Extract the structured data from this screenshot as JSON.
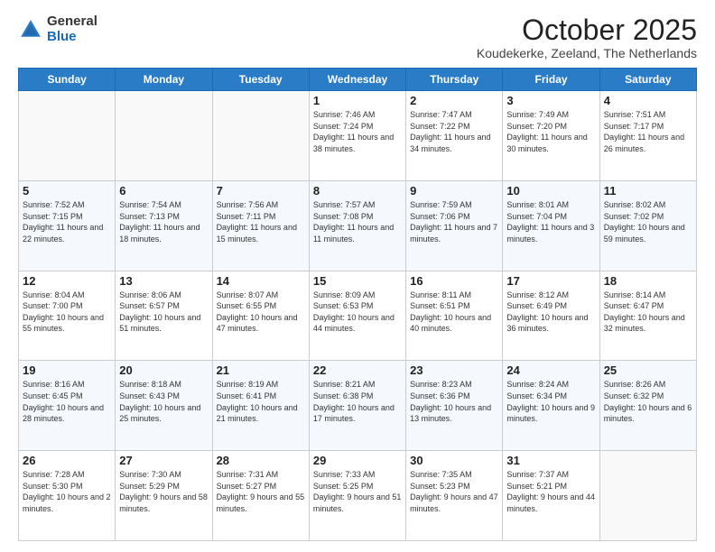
{
  "logo": {
    "general": "General",
    "blue": "Blue"
  },
  "header": {
    "month": "October 2025",
    "location": "Koudekerke, Zeeland, The Netherlands"
  },
  "weekdays": [
    "Sunday",
    "Monday",
    "Tuesday",
    "Wednesday",
    "Thursday",
    "Friday",
    "Saturday"
  ],
  "weeks": [
    [
      {
        "day": "",
        "sunrise": "",
        "sunset": "",
        "daylight": ""
      },
      {
        "day": "",
        "sunrise": "",
        "sunset": "",
        "daylight": ""
      },
      {
        "day": "",
        "sunrise": "",
        "sunset": "",
        "daylight": ""
      },
      {
        "day": "1",
        "sunrise": "Sunrise: 7:46 AM",
        "sunset": "Sunset: 7:24 PM",
        "daylight": "Daylight: 11 hours and 38 minutes."
      },
      {
        "day": "2",
        "sunrise": "Sunrise: 7:47 AM",
        "sunset": "Sunset: 7:22 PM",
        "daylight": "Daylight: 11 hours and 34 minutes."
      },
      {
        "day": "3",
        "sunrise": "Sunrise: 7:49 AM",
        "sunset": "Sunset: 7:20 PM",
        "daylight": "Daylight: 11 hours and 30 minutes."
      },
      {
        "day": "4",
        "sunrise": "Sunrise: 7:51 AM",
        "sunset": "Sunset: 7:17 PM",
        "daylight": "Daylight: 11 hours and 26 minutes."
      }
    ],
    [
      {
        "day": "5",
        "sunrise": "Sunrise: 7:52 AM",
        "sunset": "Sunset: 7:15 PM",
        "daylight": "Daylight: 11 hours and 22 minutes."
      },
      {
        "day": "6",
        "sunrise": "Sunrise: 7:54 AM",
        "sunset": "Sunset: 7:13 PM",
        "daylight": "Daylight: 11 hours and 18 minutes."
      },
      {
        "day": "7",
        "sunrise": "Sunrise: 7:56 AM",
        "sunset": "Sunset: 7:11 PM",
        "daylight": "Daylight: 11 hours and 15 minutes."
      },
      {
        "day": "8",
        "sunrise": "Sunrise: 7:57 AM",
        "sunset": "Sunset: 7:08 PM",
        "daylight": "Daylight: 11 hours and 11 minutes."
      },
      {
        "day": "9",
        "sunrise": "Sunrise: 7:59 AM",
        "sunset": "Sunset: 7:06 PM",
        "daylight": "Daylight: 11 hours and 7 minutes."
      },
      {
        "day": "10",
        "sunrise": "Sunrise: 8:01 AM",
        "sunset": "Sunset: 7:04 PM",
        "daylight": "Daylight: 11 hours and 3 minutes."
      },
      {
        "day": "11",
        "sunrise": "Sunrise: 8:02 AM",
        "sunset": "Sunset: 7:02 PM",
        "daylight": "Daylight: 10 hours and 59 minutes."
      }
    ],
    [
      {
        "day": "12",
        "sunrise": "Sunrise: 8:04 AM",
        "sunset": "Sunset: 7:00 PM",
        "daylight": "Daylight: 10 hours and 55 minutes."
      },
      {
        "day": "13",
        "sunrise": "Sunrise: 8:06 AM",
        "sunset": "Sunset: 6:57 PM",
        "daylight": "Daylight: 10 hours and 51 minutes."
      },
      {
        "day": "14",
        "sunrise": "Sunrise: 8:07 AM",
        "sunset": "Sunset: 6:55 PM",
        "daylight": "Daylight: 10 hours and 47 minutes."
      },
      {
        "day": "15",
        "sunrise": "Sunrise: 8:09 AM",
        "sunset": "Sunset: 6:53 PM",
        "daylight": "Daylight: 10 hours and 44 minutes."
      },
      {
        "day": "16",
        "sunrise": "Sunrise: 8:11 AM",
        "sunset": "Sunset: 6:51 PM",
        "daylight": "Daylight: 10 hours and 40 minutes."
      },
      {
        "day": "17",
        "sunrise": "Sunrise: 8:12 AM",
        "sunset": "Sunset: 6:49 PM",
        "daylight": "Daylight: 10 hours and 36 minutes."
      },
      {
        "day": "18",
        "sunrise": "Sunrise: 8:14 AM",
        "sunset": "Sunset: 6:47 PM",
        "daylight": "Daylight: 10 hours and 32 minutes."
      }
    ],
    [
      {
        "day": "19",
        "sunrise": "Sunrise: 8:16 AM",
        "sunset": "Sunset: 6:45 PM",
        "daylight": "Daylight: 10 hours and 28 minutes."
      },
      {
        "day": "20",
        "sunrise": "Sunrise: 8:18 AM",
        "sunset": "Sunset: 6:43 PM",
        "daylight": "Daylight: 10 hours and 25 minutes."
      },
      {
        "day": "21",
        "sunrise": "Sunrise: 8:19 AM",
        "sunset": "Sunset: 6:41 PM",
        "daylight": "Daylight: 10 hours and 21 minutes."
      },
      {
        "day": "22",
        "sunrise": "Sunrise: 8:21 AM",
        "sunset": "Sunset: 6:38 PM",
        "daylight": "Daylight: 10 hours and 17 minutes."
      },
      {
        "day": "23",
        "sunrise": "Sunrise: 8:23 AM",
        "sunset": "Sunset: 6:36 PM",
        "daylight": "Daylight: 10 hours and 13 minutes."
      },
      {
        "day": "24",
        "sunrise": "Sunrise: 8:24 AM",
        "sunset": "Sunset: 6:34 PM",
        "daylight": "Daylight: 10 hours and 9 minutes."
      },
      {
        "day": "25",
        "sunrise": "Sunrise: 8:26 AM",
        "sunset": "Sunset: 6:32 PM",
        "daylight": "Daylight: 10 hours and 6 minutes."
      }
    ],
    [
      {
        "day": "26",
        "sunrise": "Sunrise: 7:28 AM",
        "sunset": "Sunset: 5:30 PM",
        "daylight": "Daylight: 10 hours and 2 minutes."
      },
      {
        "day": "27",
        "sunrise": "Sunrise: 7:30 AM",
        "sunset": "Sunset: 5:29 PM",
        "daylight": "Daylight: 9 hours and 58 minutes."
      },
      {
        "day": "28",
        "sunrise": "Sunrise: 7:31 AM",
        "sunset": "Sunset: 5:27 PM",
        "daylight": "Daylight: 9 hours and 55 minutes."
      },
      {
        "day": "29",
        "sunrise": "Sunrise: 7:33 AM",
        "sunset": "Sunset: 5:25 PM",
        "daylight": "Daylight: 9 hours and 51 minutes."
      },
      {
        "day": "30",
        "sunrise": "Sunrise: 7:35 AM",
        "sunset": "Sunset: 5:23 PM",
        "daylight": "Daylight: 9 hours and 47 minutes."
      },
      {
        "day": "31",
        "sunrise": "Sunrise: 7:37 AM",
        "sunset": "Sunset: 5:21 PM",
        "daylight": "Daylight: 9 hours and 44 minutes."
      },
      {
        "day": "",
        "sunrise": "",
        "sunset": "",
        "daylight": ""
      }
    ]
  ]
}
